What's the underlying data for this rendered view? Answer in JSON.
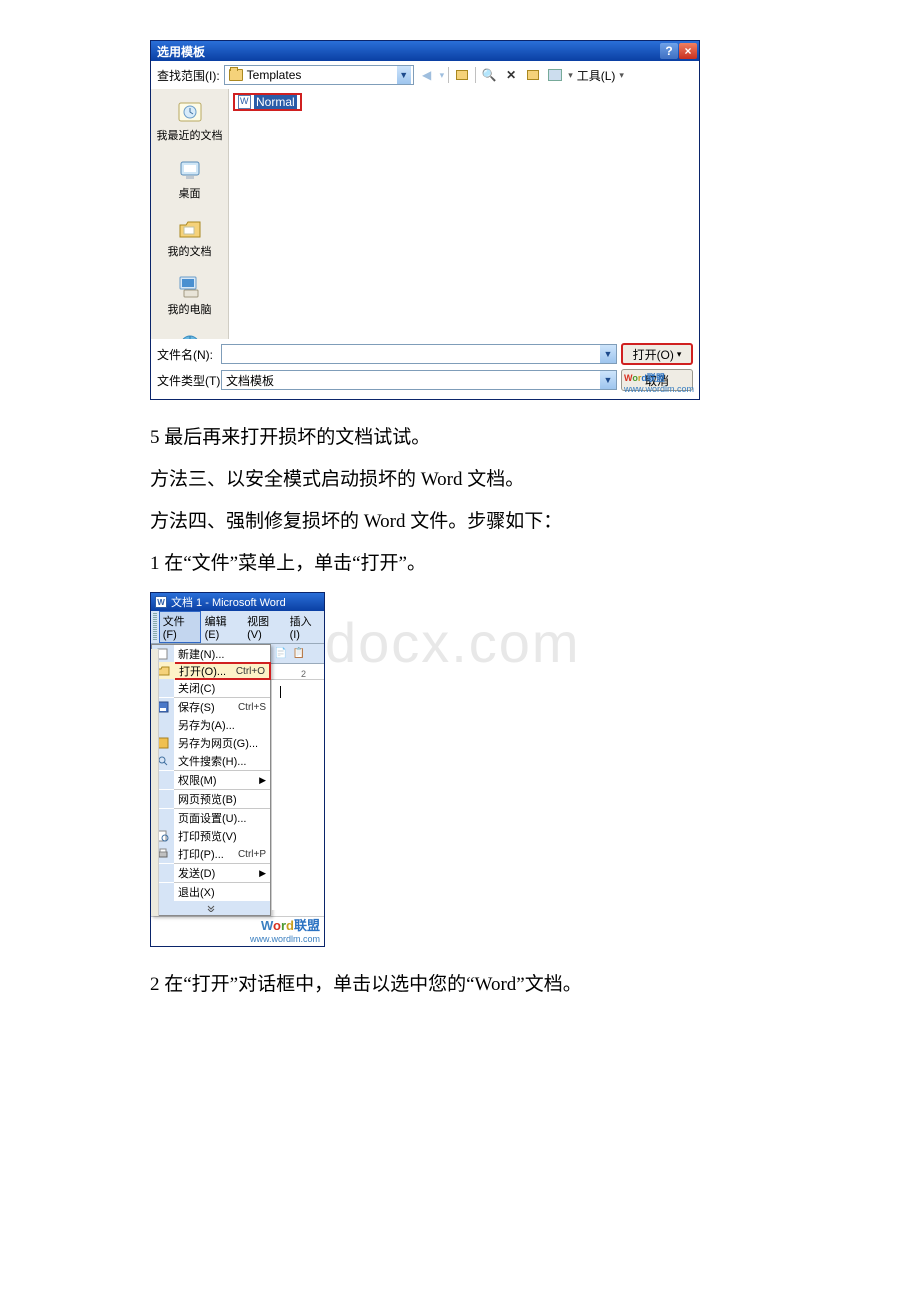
{
  "watermark": "www.bdocx.com",
  "dialog": {
    "title": "选用模板",
    "lookin_label": "查找范围(I):",
    "lookin_value": "Templates",
    "tools_label": "工具(L)",
    "selected_file": "Normal",
    "places": {
      "recent": "我最近的文档",
      "desktop": "桌面",
      "docs": "我的文档",
      "pc": "我的电脑"
    },
    "filename_label": "文件名(N):",
    "filename_value": "",
    "filetype_label": "文件类型(T):",
    "filetype_value": "文档模板",
    "open_btn": "打开(O)",
    "cancel_btn": "取消",
    "wm_url": "www.wordlm.com"
  },
  "paragraphs": {
    "p1": "5 最后再来打开损坏的文档试试。",
    "p2": "方法三、以安全模式启动损坏的 Word 文档。",
    "p3": "方法四、强制修复损坏的 Word 文件。步骤如下：",
    "p4": "1 在“文件”菜单上，单击“打开”。",
    "p5": "2 在“打开”对话框中，单击以选中您的“Word”文档。"
  },
  "word": {
    "title": "文档 1 - Microsoft Word",
    "menus": {
      "file": "文件(F)",
      "edit": "编辑(E)",
      "view": "视图(V)",
      "insert": "插入(I)"
    },
    "file_menu": {
      "new": "新建(N)...",
      "open": "打开(O)...",
      "open_sc": "Ctrl+O",
      "close": "关闭(C)",
      "save": "保存(S)",
      "save_sc": "Ctrl+S",
      "saveas": "另存为(A)...",
      "saveweb": "另存为网页(G)...",
      "search": "文件搜索(H)...",
      "perm": "权限(M)",
      "webprev": "网页预览(B)",
      "pagesetup": "页面设置(U)...",
      "printprev": "打印预览(V)",
      "print": "打印(P)...",
      "print_sc": "Ctrl+P",
      "send": "发送(D)",
      "exit": "退出(X)"
    },
    "logo_cn": "联盟",
    "logo_url": "www.wordlm.com"
  }
}
